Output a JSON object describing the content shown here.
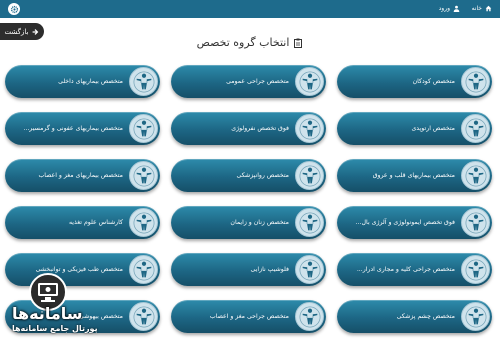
{
  "topbar": {
    "home_label": "خانه",
    "login_label": "ورود"
  },
  "back_button": {
    "label": "بازگشت"
  },
  "page_title": "انتخاب گروه تخصص",
  "specialties": [
    [
      "متخصص کودکان",
      "متخصص جراحی عمومی",
      "متخصص بیماریهای داخلی"
    ],
    [
      "متخصص ارتوپدی",
      "فوق تخصص نفرولوژی",
      "متخصص بیماریهای عفونی و گرمسیر..."
    ],
    [
      "متخصص بیماریهای قلب و عروق",
      "متخصص روانپزشکی",
      "متخصص بیماریهای مغز و اعصاب"
    ],
    [
      "فوق تخصص ایمونولوژی و آلرژی بال...",
      "متخصص زنان و زایمان",
      "کارشناس علوم تغذیه"
    ],
    [
      "متخصص جراحی کلیه و مجاری ادرار...",
      "فلوشیپ نازایی",
      "متخصص طب فیزیکی و توانبخشی"
    ],
    [
      "متخصص چشم پزشکی",
      "متخصص جراحی مغز و اعصاب",
      "متخصص بیهوشی"
    ]
  ],
  "watermark": {
    "title": "سامانه‌ها",
    "subtitle": "پورتال جامع سامانه‌ها"
  },
  "colors": {
    "topbar": "#1e6b8c",
    "card_top": "#2d8bab",
    "card_bottom": "#154f68",
    "badge": "#cfe3ec"
  }
}
